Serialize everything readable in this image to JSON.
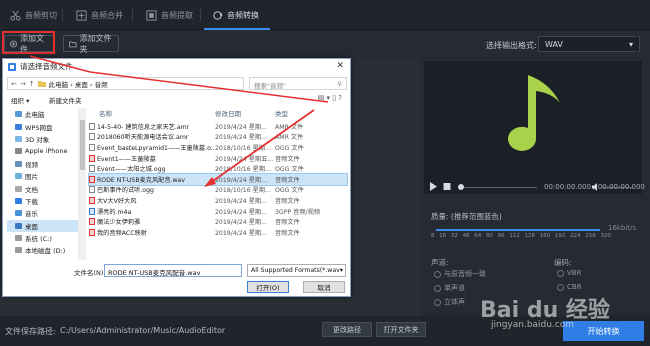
{
  "tabs": [
    {
      "label": "音频剪切"
    },
    {
      "label": "音频合并"
    },
    {
      "label": "音频提取"
    },
    {
      "label": "音频转换"
    }
  ],
  "toolbar": {
    "add_file": "添加文件",
    "add_folder": "添加文件夹",
    "format_label": "选择输出格式:",
    "format_value": "WAV"
  },
  "player": {
    "time": "00:00:00.000 / 00:00:00.000"
  },
  "settings": {
    "quality_label": "质量: (推荐范围蓝色)",
    "rate_label": "16kbit/s",
    "ticks": [
      "8",
      "16",
      "32",
      "48",
      "64",
      "80",
      "96",
      "112",
      "128",
      "160",
      "192",
      "224",
      "256",
      "320"
    ],
    "channel_label": "声道:",
    "channel_options": [
      "与原音频一致",
      "单声道",
      "立体声"
    ],
    "encode_label": "编码:",
    "encode_options": [
      "VBR",
      "CBR"
    ]
  },
  "bottom": {
    "path_label": "文件保存路径:",
    "path_value": "C:/Users/Administrator/Music/AudioEditor",
    "change_path": "更改路径",
    "open_folder": "打开文件夹",
    "start": "开始转换"
  },
  "dialog": {
    "title": "请选择音频文件",
    "address": "此电脑 › 桌面 › 音频",
    "search_placeholder": "搜索\"音频\"",
    "organize": "组织 ▾",
    "new_folder": "新建文件夹",
    "tree": [
      {
        "label": "此电脑"
      },
      {
        "label": "WPS网盘"
      },
      {
        "label": "3D 对象"
      },
      {
        "label": "Apple iPhone"
      },
      {
        "label": "视频"
      },
      {
        "label": "图片"
      },
      {
        "label": "文档"
      },
      {
        "label": "下载"
      },
      {
        "label": "音乐"
      },
      {
        "label": "桌面"
      },
      {
        "label": "系统 (C:)"
      },
      {
        "label": "本地磁盘 (D:)"
      }
    ],
    "columns": {
      "name": "名称",
      "date": "修改日期",
      "type": "类型"
    },
    "files": [
      {
        "name": "14-5-40- 建筑信息之家天艺.amr",
        "date": "2019/4/24 星期...",
        "type": "AMR 文件"
      },
      {
        "name": "2018060听天能源电话会议.amr",
        "date": "2019/4/24 星期...",
        "type": "AMR 文件"
      },
      {
        "name": "Event_basteLpyramid1——王童陵墓.o...",
        "date": "2018/10/16 星期...",
        "type": "OGG 文件"
      },
      {
        "name": "Event1——王童陵墓",
        "date": "2019/4/24 星期五...",
        "type": "音频文件"
      },
      {
        "name": "Event——太阳之城.ogg",
        "date": "2018/10/16 星期...",
        "type": "OGG 文件"
      },
      {
        "name": "RODE NT-USB麦克风配音.wav",
        "date": "2019/4/24 星期...",
        "type": "音频文件"
      },
      {
        "name": "巴斯事件的试听.ogg",
        "date": "2018/10/16 星期...",
        "type": "OGG 文件"
      },
      {
        "name": "大V大V好大风",
        "date": "2019/4/24 星期...",
        "type": "音频文件"
      },
      {
        "name": "漂亮的.m4a",
        "date": "2019/4/24 星期...",
        "type": "3GPP 音频/视频"
      },
      {
        "name": "魔法少女伊莉雅",
        "date": "2019/4/24 星期...",
        "type": "音频文件"
      },
      {
        "name": "我的音频ACC映射",
        "date": "2019/4/24 星期...",
        "type": "音频文件"
      }
    ],
    "filename_label": "文件名(N):",
    "filename_value": "RODE NT-USB麦克风配音.wav",
    "filetype_value": "All Supported Formats(*.wav",
    "open": "打开(O)",
    "cancel": "取消"
  },
  "watermark": {
    "brand": "Bai du 经验",
    "url": "jingyan.baidu.com"
  },
  "colors": {
    "accent": "#2f7de5",
    "highlight_box": "#e53030",
    "music_note": "#a8d24a"
  }
}
